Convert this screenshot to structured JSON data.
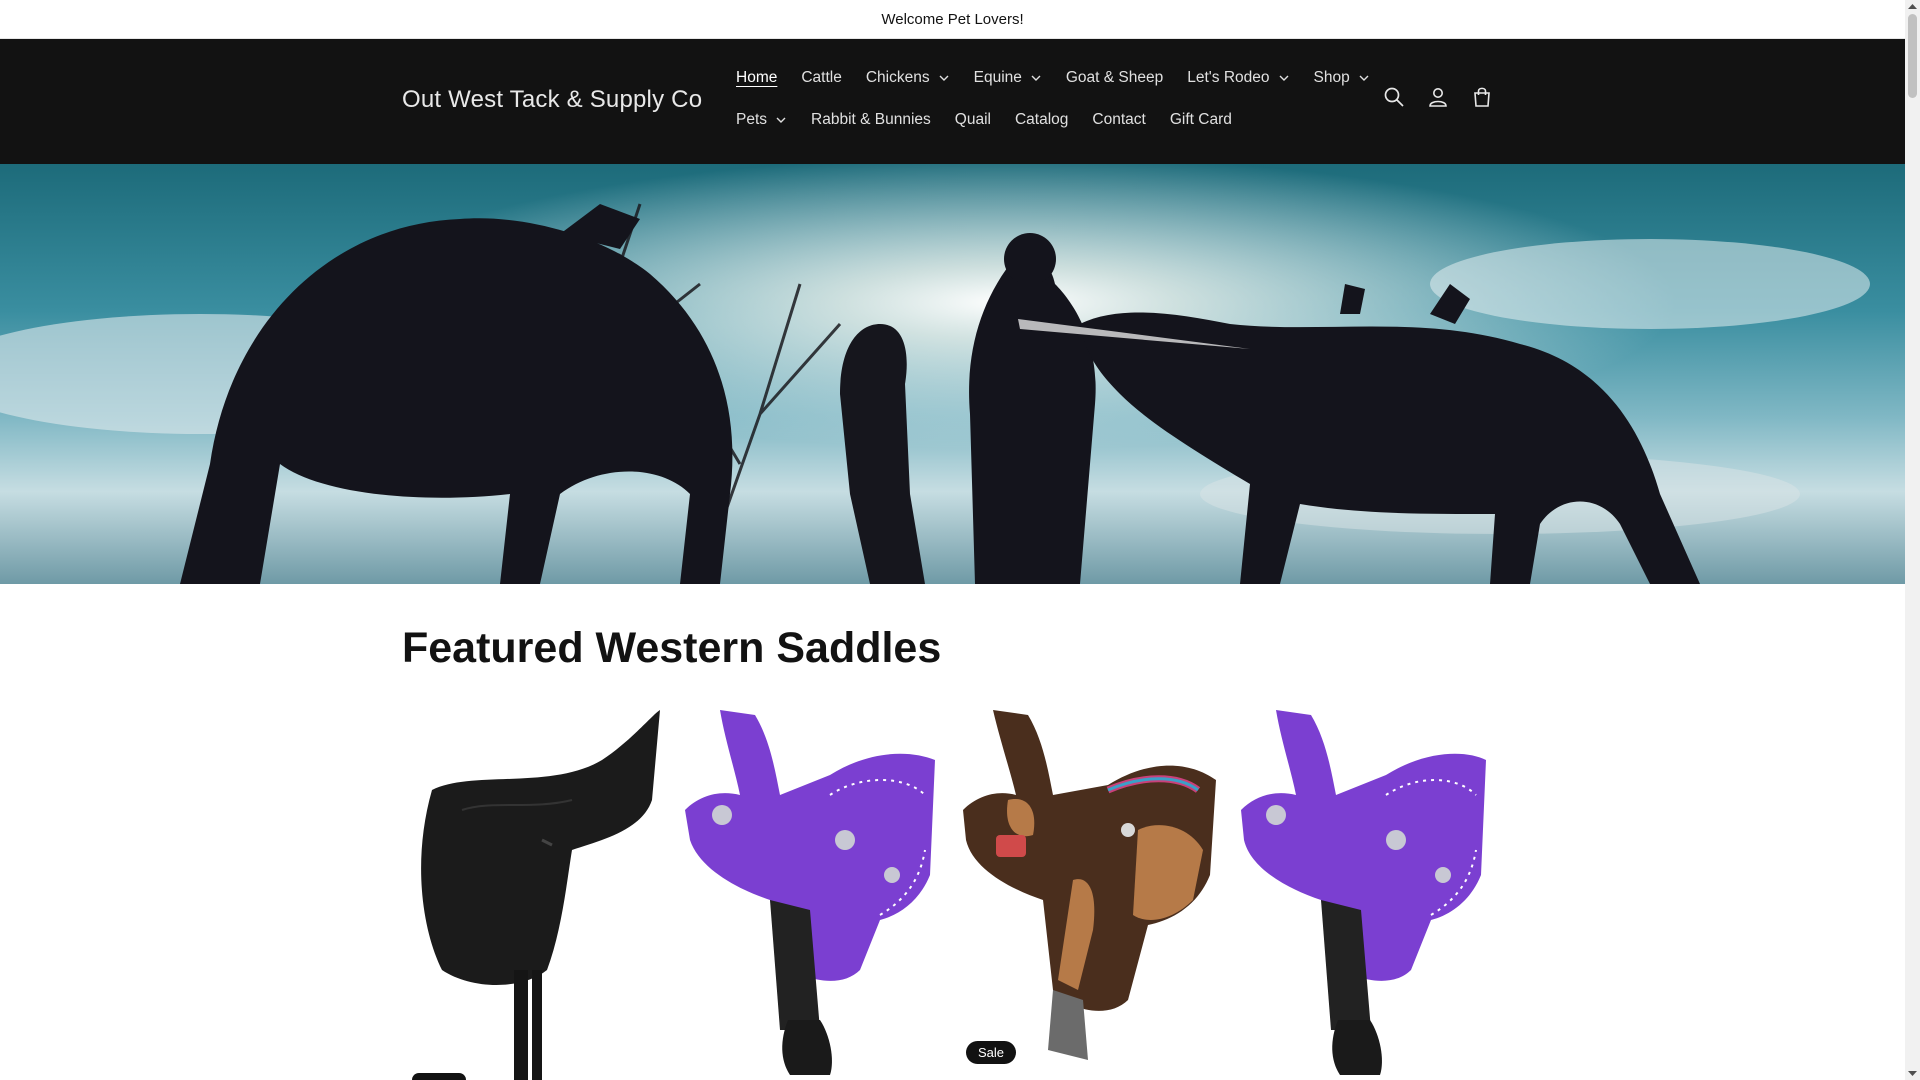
{
  "announcement": {
    "text": "Welcome Pet Lovers!"
  },
  "header": {
    "logo": "Out West Tack & Supply Co",
    "nav_row1": [
      {
        "label": "Home",
        "dropdown": false,
        "active": true
      },
      {
        "label": "Cattle",
        "dropdown": false
      },
      {
        "label": "Chickens",
        "dropdown": true
      },
      {
        "label": "Equine",
        "dropdown": true
      },
      {
        "label": "Goat & Sheep",
        "dropdown": false
      },
      {
        "label": "Let's Rodeo",
        "dropdown": true
      },
      {
        "label": "Shop",
        "dropdown": true
      }
    ],
    "nav_row2": [
      {
        "label": "Pets",
        "dropdown": true
      },
      {
        "label": "Rabbit & Bunnies",
        "dropdown": false
      },
      {
        "label": "Quail",
        "dropdown": false
      },
      {
        "label": "Catalog",
        "dropdown": false
      },
      {
        "label": "Contact",
        "dropdown": false
      },
      {
        "label": "Gift Card",
        "dropdown": false
      }
    ],
    "icons": [
      "search-icon",
      "account-icon",
      "cart-icon"
    ]
  },
  "featured": {
    "title": "Featured Western Saddles",
    "products": [
      {
        "image": "black-english-saddle"
      },
      {
        "image": "purple-western-saddle"
      },
      {
        "image": "brown-tooled-western-saddle",
        "badge": "Sale"
      },
      {
        "image": "purple-western-saddle"
      }
    ]
  },
  "colors": {
    "header_bg": "#121212",
    "page_bg": "#ffffff",
    "accent_purple": "#7b3fd1"
  }
}
